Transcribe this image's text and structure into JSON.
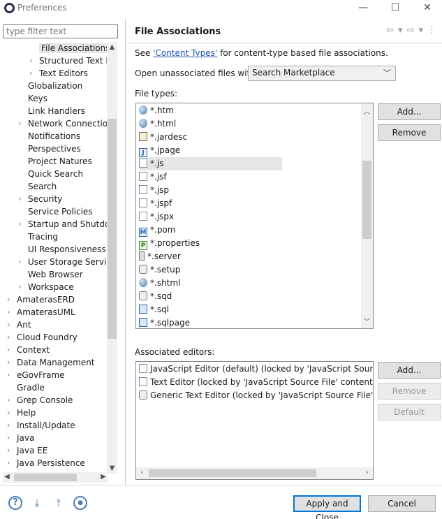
{
  "window": {
    "title": "Preferences",
    "minimize": "—",
    "maximize": "☐",
    "close": "✕"
  },
  "filter": {
    "placeholder": "type filter text"
  },
  "tree": {
    "items": [
      {
        "label": "File Associations",
        "indent": 3,
        "twisty": "",
        "selected": true
      },
      {
        "label": "Structured Text Ec",
        "indent": 3,
        "twisty": "›"
      },
      {
        "label": "Text Editors",
        "indent": 3,
        "twisty": "›"
      },
      {
        "label": "Globalization",
        "indent": 2,
        "twisty": ""
      },
      {
        "label": "Keys",
        "indent": 2,
        "twisty": ""
      },
      {
        "label": "Link Handlers",
        "indent": 2,
        "twisty": ""
      },
      {
        "label": "Network Connection",
        "indent": 2,
        "twisty": "›"
      },
      {
        "label": "Notifications",
        "indent": 2,
        "twisty": ""
      },
      {
        "label": "Perspectives",
        "indent": 2,
        "twisty": ""
      },
      {
        "label": "Project Natures",
        "indent": 2,
        "twisty": ""
      },
      {
        "label": "Quick Search",
        "indent": 2,
        "twisty": ""
      },
      {
        "label": "Search",
        "indent": 2,
        "twisty": ""
      },
      {
        "label": "Security",
        "indent": 2,
        "twisty": "›"
      },
      {
        "label": "Service Policies",
        "indent": 2,
        "twisty": ""
      },
      {
        "label": "Startup and Shutdow",
        "indent": 2,
        "twisty": "›"
      },
      {
        "label": "Tracing",
        "indent": 2,
        "twisty": ""
      },
      {
        "label": "UI Responsiveness M",
        "indent": 2,
        "twisty": ""
      },
      {
        "label": "User Storage Service",
        "indent": 2,
        "twisty": "›"
      },
      {
        "label": "Web Browser",
        "indent": 2,
        "twisty": ""
      },
      {
        "label": "Workspace",
        "indent": 2,
        "twisty": "›"
      },
      {
        "label": "AmaterasERD",
        "indent": 1,
        "twisty": "›"
      },
      {
        "label": "AmaterasUML",
        "indent": 1,
        "twisty": "›"
      },
      {
        "label": "Ant",
        "indent": 1,
        "twisty": "›"
      },
      {
        "label": "Cloud Foundry",
        "indent": 1,
        "twisty": "›"
      },
      {
        "label": "Context",
        "indent": 1,
        "twisty": "›"
      },
      {
        "label": "Data Management",
        "indent": 1,
        "twisty": "›"
      },
      {
        "label": "eGovFrame",
        "indent": 1,
        "twisty": "›"
      },
      {
        "label": "Gradle",
        "indent": 1,
        "twisty": ""
      },
      {
        "label": "Grep Console",
        "indent": 1,
        "twisty": "›"
      },
      {
        "label": "Help",
        "indent": 1,
        "twisty": "›"
      },
      {
        "label": "Install/Update",
        "indent": 1,
        "twisty": "›"
      },
      {
        "label": "Java",
        "indent": 1,
        "twisty": "›"
      },
      {
        "label": "Java EE",
        "indent": 1,
        "twisty": "›"
      },
      {
        "label": "Java Persistence",
        "indent": 1,
        "twisty": "›"
      }
    ]
  },
  "page": {
    "title": "File Associations",
    "see_prefix": "See ",
    "see_link": "'Content Types'",
    "see_suffix": " for content-type based file associations.",
    "open_label": "Open unassociated files with:",
    "open_value": "Search Marketplace",
    "file_types_label": "File types:",
    "file_types": [
      {
        "name": "*.htm",
        "icon": "globe"
      },
      {
        "name": "*.html",
        "icon": "globe"
      },
      {
        "name": "*.jardesc",
        "icon": "jar"
      },
      {
        "name": "*.jpage",
        "icon": "blue",
        "glyph": "J"
      },
      {
        "name": "*.js",
        "icon": "doc",
        "selected": true
      },
      {
        "name": "*.jsf",
        "icon": "doc"
      },
      {
        "name": "*.jsp",
        "icon": "doc"
      },
      {
        "name": "*.jspf",
        "icon": "doc"
      },
      {
        "name": "*.jspx",
        "icon": "doc"
      },
      {
        "name": "*.pom",
        "icon": "blue",
        "glyph": "M"
      },
      {
        "name": "*.properties",
        "icon": "green",
        "glyph": "P"
      },
      {
        "name": "*.server",
        "icon": "server"
      },
      {
        "name": "*.setup",
        "icon": "gear"
      },
      {
        "name": "*.shtml",
        "icon": "globe"
      },
      {
        "name": "*.sqd",
        "icon": "gear"
      },
      {
        "name": "*.sql",
        "icon": "sql"
      },
      {
        "name": "*.sqlpage",
        "icon": "sql"
      }
    ],
    "file_types_buttons": {
      "add": "Add...",
      "remove": "Remove"
    },
    "assoc_label": "Associated editors:",
    "editors": [
      {
        "name": "JavaScript Editor (default) (locked by 'JavaScript Source Fil",
        "icon": "doc"
      },
      {
        "name": "Text Editor (locked by 'JavaScript Source File' content type",
        "icon": "doc"
      },
      {
        "name": "Generic Text Editor (locked by 'JavaScript Source File' cont",
        "icon": "gear"
      }
    ],
    "editor_buttons": {
      "add": "Add...",
      "remove": "Remove",
      "default": "Default"
    }
  },
  "footer": {
    "help_icon": "?",
    "import_icon": "⤓",
    "export_icon": "⤒",
    "record_icon": "●",
    "apply_close": "Apply and Close",
    "cancel": "Cancel"
  },
  "nav": {
    "back": "⇦",
    "menu": "▾",
    "forward": "⇨",
    "more": "⋮"
  }
}
